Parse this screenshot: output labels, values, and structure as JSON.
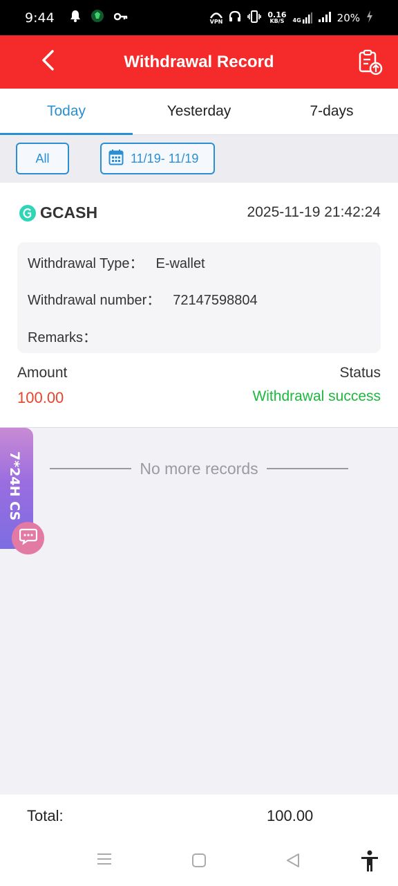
{
  "status_bar": {
    "time": "9:44",
    "vpn": "VPN",
    "speed_value": "0.16",
    "speed_unit": "KB/S",
    "network": "4G",
    "battery": "20%"
  },
  "header": {
    "title": "Withdrawal Record"
  },
  "tabs": [
    {
      "label": "Today",
      "active": true
    },
    {
      "label": "Yesterday",
      "active": false
    },
    {
      "label": "7-days",
      "active": false
    }
  ],
  "filters": {
    "all_label": "All",
    "date_range": "11/19- 11/19"
  },
  "record": {
    "brand": "GCASH",
    "datetime": "2025-11-19 21:42:24",
    "type_label": "Withdrawal Type：",
    "type_value": "E-wallet",
    "number_label": "Withdrawal number：",
    "number_value": "72147598804",
    "remarks_label": "Remarks：",
    "amount_label": "Amount",
    "amount_value": "100.00",
    "status_label": "Status",
    "status_value": "Withdrawal success"
  },
  "list_end": "No more records",
  "customer_service": {
    "label": "7*24H CS"
  },
  "total": {
    "label": "Total:",
    "value": "100.00"
  },
  "colors": {
    "header": "#f52b2b",
    "accent": "#2a8fd2",
    "amount": "#e8432b",
    "success": "#1cb93d"
  }
}
